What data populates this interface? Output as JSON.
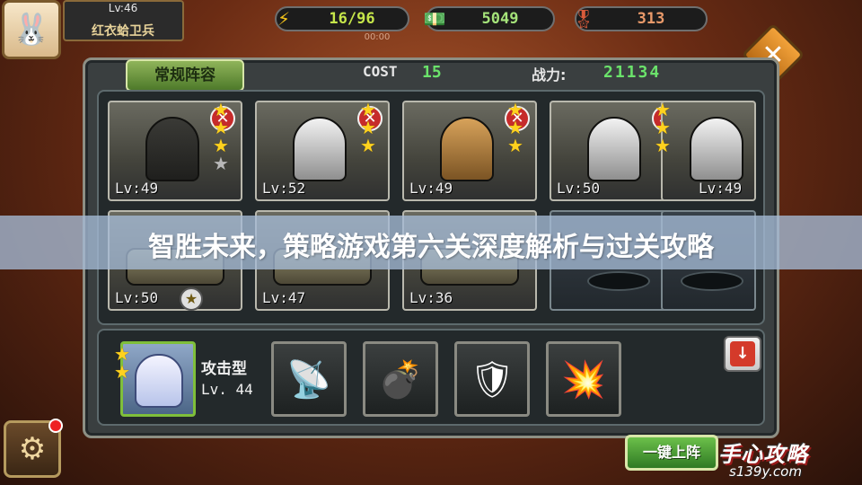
{
  "player": {
    "level": "Lv:46",
    "title": "红衣蛤卫兵"
  },
  "resources": {
    "energy": "16/96",
    "cash": "5049",
    "medals": "313",
    "timer": "00:00"
  },
  "formation": {
    "tab_label": "常规阵容",
    "cost_label": "COST",
    "cost_value": "15",
    "power_label": "战力:",
    "power_value": "21134"
  },
  "units_top": [
    {
      "level": "Lv:49",
      "stars": 0,
      "max": 4
    },
    {
      "level": "Lv:52",
      "stars": 3,
      "max": 4
    },
    {
      "level": "Lv:49",
      "stars": 3,
      "max": 3
    },
    {
      "level": "Lv:50",
      "stars": 3,
      "max": 3
    },
    {
      "level": "Lv:49",
      "stars": 3,
      "max": 3
    }
  ],
  "units_bottom": [
    {
      "level": "Lv:50"
    },
    {
      "level": "Lv:47"
    },
    {
      "level": "Lv:36"
    },
    {
      "level": ""
    },
    {
      "level": ""
    }
  ],
  "banner": {
    "title": "智胜未来，策略游戏第六关深度解析与过关攻略"
  },
  "hero": {
    "type": "攻击型",
    "level": "Lv. 44",
    "stars": 2
  },
  "equipment": [
    {
      "icon": "radio-device-icon",
      "glyph": "📡"
    },
    {
      "icon": "grenade-crate-icon",
      "glyph": "💣"
    },
    {
      "icon": "turret-icon",
      "glyph": "🛡"
    },
    {
      "icon": "explosion-icon",
      "glyph": "💥"
    }
  ],
  "actions": {
    "quick_deploy": "一键上阵",
    "close": "✕",
    "scroll_down": "↓"
  },
  "watermark": {
    "brand": "手心攻略",
    "url": "s139y.com"
  }
}
